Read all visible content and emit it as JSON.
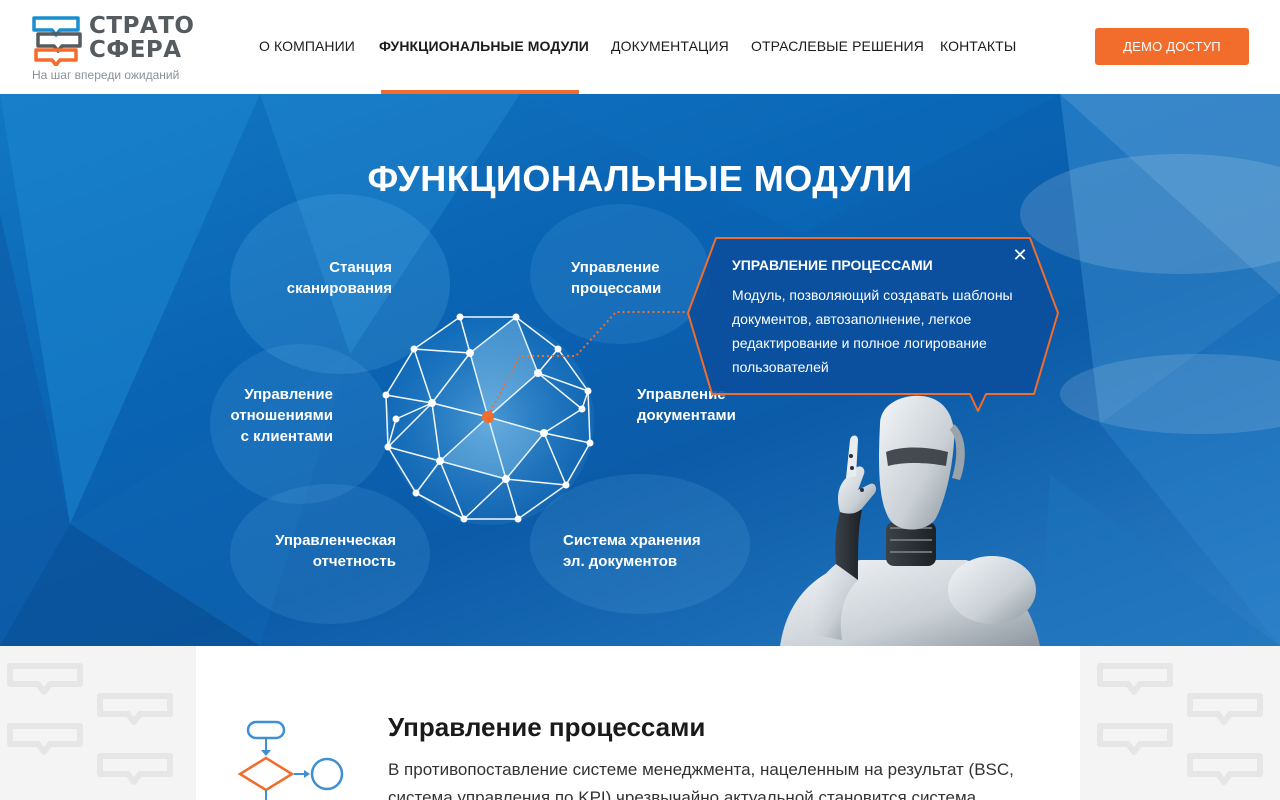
{
  "header": {
    "logo": {
      "line1": "СТРАТО",
      "line2": "СФЕРА",
      "tagline": "На шаг впереди ожиданий"
    },
    "nav": [
      {
        "label": "О КОМПАНИИ",
        "active": false
      },
      {
        "label": "ФУНКЦИОНАЛЬНЫЕ МОДУЛИ",
        "active": true
      },
      {
        "label": "ДОКУМЕНТАЦИЯ",
        "active": false
      },
      {
        "label": "ОТРАСЛЕВЫЕ РЕШЕНИЯ",
        "active": false
      },
      {
        "label": "КОНТАКТЫ",
        "active": false
      }
    ],
    "demo_button": "ДЕМО ДОСТУП"
  },
  "hero": {
    "title": "ФУНКЦИОНАЛЬНЫЕ МОДУЛИ",
    "modules": [
      {
        "line1": "Станция",
        "line2": "сканирования"
      },
      {
        "line1": "Управление",
        "line2": "процессами"
      },
      {
        "line1": "Управление",
        "line2": "отношениями",
        "line3": "с клиентами"
      },
      {
        "line1": "Управление",
        "line2": "документами"
      },
      {
        "line1": "Управленческая",
        "line2": "отчетность"
      },
      {
        "line1": "Система хранения",
        "line2": "эл. документов"
      }
    ],
    "tooltip": {
      "title": "УПРАВЛЕНИЕ ПРОЦЕССАМИ",
      "body": "Модуль, позволяющий создавать шаблоны документов, автозаполнение, легкое редактирование и полное логирование пользователей",
      "close_icon": "close-icon"
    }
  },
  "content": {
    "title": "Управление процессами",
    "text": "В противопоставление системе менеджмента, нацеленным на результат (BSC, система управления по KPI) чрезвычайно актуальной становится система"
  },
  "colors": {
    "accent": "#f26c2b",
    "hero_blue": "#0a64b4",
    "logo_gray": "#555b5f",
    "logo_blue": "#1a8fd0"
  }
}
